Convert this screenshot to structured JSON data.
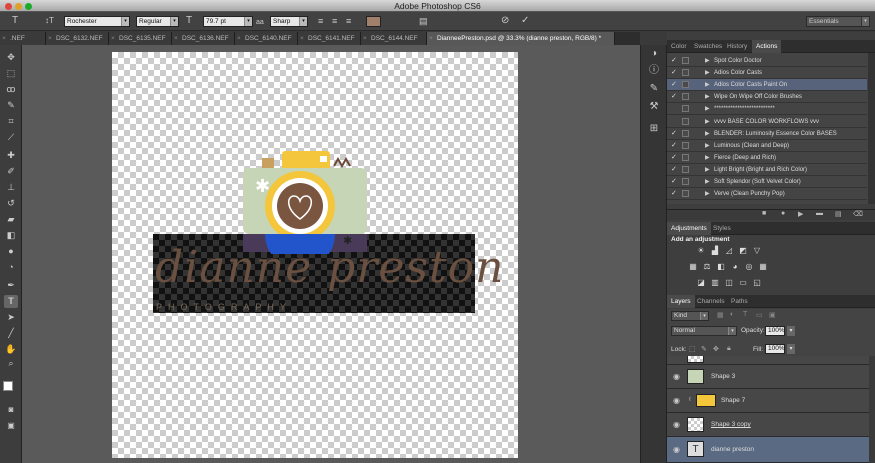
{
  "window": {
    "title": "Adobe Photoshop CS6"
  },
  "options": {
    "font_family": "Rochester",
    "font_style": "Regular",
    "font_size": "79.7 pt",
    "anti_alias": "Sharp",
    "color": "#a0806a",
    "workspace": "Essentials"
  },
  "tabs": [
    {
      "label": ".NEF",
      "active": false
    },
    {
      "label": "DSC_6132.NEF",
      "active": false
    },
    {
      "label": "DSC_6135.NEF",
      "active": false
    },
    {
      "label": "DSC_6136.NEF",
      "active": false
    },
    {
      "label": "DSC_6140.NEF",
      "active": false
    },
    {
      "label": "DSC_6141.NEF",
      "active": false
    },
    {
      "label": "DSC_6144.NEF",
      "active": false
    },
    {
      "label": "DianneePreston.psd @ 33.3% (dianne preston, RGB/8) *",
      "active": true
    }
  ],
  "canvas": {
    "logo_text": "dianne preston",
    "logo_subtext": "PHOTOGRAPHY"
  },
  "actions_panel": {
    "tabs": [
      "Color",
      "Swatches",
      "History",
      "Actions"
    ],
    "active_tab": "Actions",
    "items": [
      {
        "label": "Spot Color Doctor",
        "checked": true,
        "highlight": false
      },
      {
        "label": "Adios Color Casts",
        "checked": true,
        "highlight": false
      },
      {
        "label": "Adios Color Casts Paint On",
        "checked": true,
        "highlight": true
      },
      {
        "label": "Wipe On Wipe Off Color Brushes",
        "checked": true,
        "highlight": false
      },
      {
        "label": "**************************",
        "checked": false,
        "highlight": false
      },
      {
        "label": "vvvv   BASE COLOR WORKFLOWS   vvv",
        "checked": false,
        "highlight": false
      },
      {
        "label": "BLENDER: Luminosity Essence Color BASES",
        "checked": true,
        "highlight": false
      },
      {
        "label": "Luminous (Clean and Deep)",
        "checked": true,
        "highlight": false
      },
      {
        "label": "Fierce (Deep and Rich)",
        "checked": true,
        "highlight": false
      },
      {
        "label": "Light Bright (Bright and Rich Color)",
        "checked": true,
        "highlight": false
      },
      {
        "label": "Soft Splendor (Soft Velvet Color)",
        "checked": true,
        "highlight": false
      },
      {
        "label": "Verve (Clean Punchy Pop)",
        "checked": true,
        "highlight": false
      }
    ]
  },
  "adjustments_panel": {
    "tabs": [
      "Adjustments",
      "Styles"
    ],
    "heading": "Add an adjustment"
  },
  "layers_panel": {
    "tabs": [
      "Layers",
      "Channels",
      "Paths"
    ],
    "filter_kind": "Kind",
    "blend_mode": "Normal",
    "opacity_label": "Opacity:",
    "opacity": "100%",
    "lock_label": "Lock:",
    "fill_label": "Fill:",
    "fill": "100%",
    "layers": [
      {
        "name": "Shape 3",
        "type": "shape",
        "selected": false
      },
      {
        "name": "Shape 7",
        "type": "group",
        "selected": false
      },
      {
        "name": "Shape 3 copy",
        "type": "shape",
        "selected": false
      },
      {
        "name": "dianne preston",
        "type": "text",
        "selected": true
      }
    ]
  }
}
